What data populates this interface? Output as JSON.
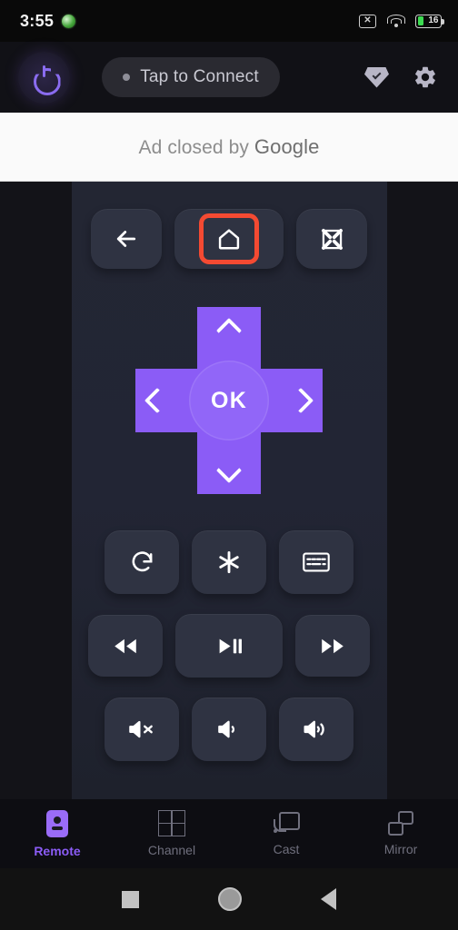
{
  "status_bar": {
    "time": "3:55",
    "app_indicator_icon": "green-app-dot-icon",
    "icons": [
      "no-sim-x-icon",
      "wifi-icon",
      "battery-icon"
    ],
    "battery_level": "16"
  },
  "top_bar": {
    "power_icon": "power-icon",
    "connect": {
      "label": "Tap to Connect",
      "status_dot_color": "#8e8e98"
    },
    "premium_icon": "diamond-gem-icon",
    "settings_icon": "gear-icon"
  },
  "ad": {
    "text": "Ad closed by ",
    "brand": "Google"
  },
  "remote": {
    "nav_row": [
      {
        "name": "back",
        "icon": "arrow-left-icon",
        "highlighted": false
      },
      {
        "name": "home",
        "icon": "home-icon",
        "highlighted": true
      },
      {
        "name": "fullscreen",
        "icon": "fullscreen-icon",
        "highlighted": false
      }
    ],
    "dpad": {
      "ok_label": "OK",
      "up_icon": "chevron-up-icon",
      "down_icon": "chevron-down-icon",
      "left_icon": "chevron-left-icon",
      "right_icon": "chevron-right-icon",
      "color": "#8b5cf6"
    },
    "function_row": [
      {
        "name": "replay",
        "icon": "replay-rotate-icon"
      },
      {
        "name": "options",
        "icon": "asterisk-icon"
      },
      {
        "name": "keyboard",
        "icon": "keyboard-icon"
      }
    ],
    "media_row": [
      {
        "name": "rewind",
        "icon": "rewind-icon"
      },
      {
        "name": "play-pause",
        "icon": "play-pause-icon"
      },
      {
        "name": "fast-forward",
        "icon": "fast-forward-icon"
      }
    ],
    "volume_row": [
      {
        "name": "mute",
        "icon": "volume-mute-icon"
      },
      {
        "name": "volume-down",
        "icon": "volume-down-icon"
      },
      {
        "name": "volume-up",
        "icon": "volume-up-icon"
      }
    ],
    "highlight_color": "#f44a32"
  },
  "bottom_nav": {
    "active": "Remote",
    "active_color": "#8b5cf6",
    "items": [
      {
        "label": "Remote",
        "icon": "remote-control-icon"
      },
      {
        "label": "Channel",
        "icon": "grid-icon"
      },
      {
        "label": "Cast",
        "icon": "cast-icon"
      },
      {
        "label": "Mirror",
        "icon": "screen-mirror-icon"
      }
    ]
  },
  "system_nav": {
    "recents_icon": "square-recents-icon",
    "home_icon": "circle-home-icon",
    "back_icon": "triangle-back-icon"
  }
}
